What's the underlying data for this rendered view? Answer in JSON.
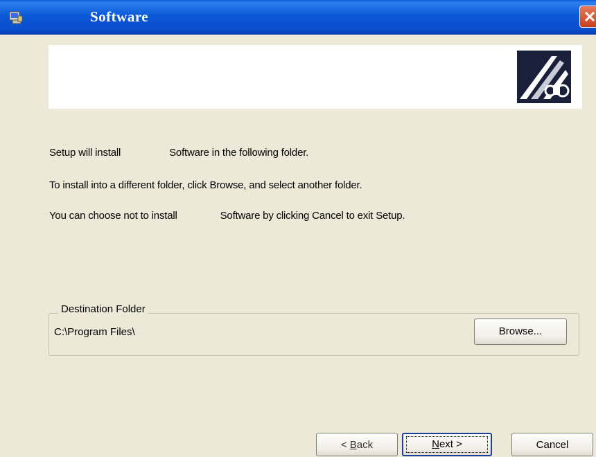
{
  "window": {
    "title": "Software"
  },
  "body_text": {
    "line1_a": "Setup will install",
    "line1_b": "Software in the following folder.",
    "line2": "To install into a different folder, click Browse, and select another folder.",
    "line3_a": "You can choose not to install",
    "line3_b": "Software by clicking Cancel to exit Setup."
  },
  "destination": {
    "label": "Destination Folder",
    "path": "C:\\Program Files\\",
    "browse_label": "Browse..."
  },
  "buttons": {
    "back_prefix": "< ",
    "back_key": "B",
    "back_rest": "ack",
    "next_key": "N",
    "next_rest": "ext >",
    "cancel": "Cancel"
  },
  "icons": {
    "app": "setup-app-icon",
    "close": "close-icon",
    "banner_logo": "installer-logo"
  },
  "colors": {
    "titlebar": "#0a54d4",
    "background": "#ece9d8",
    "close": "#d9552c"
  }
}
